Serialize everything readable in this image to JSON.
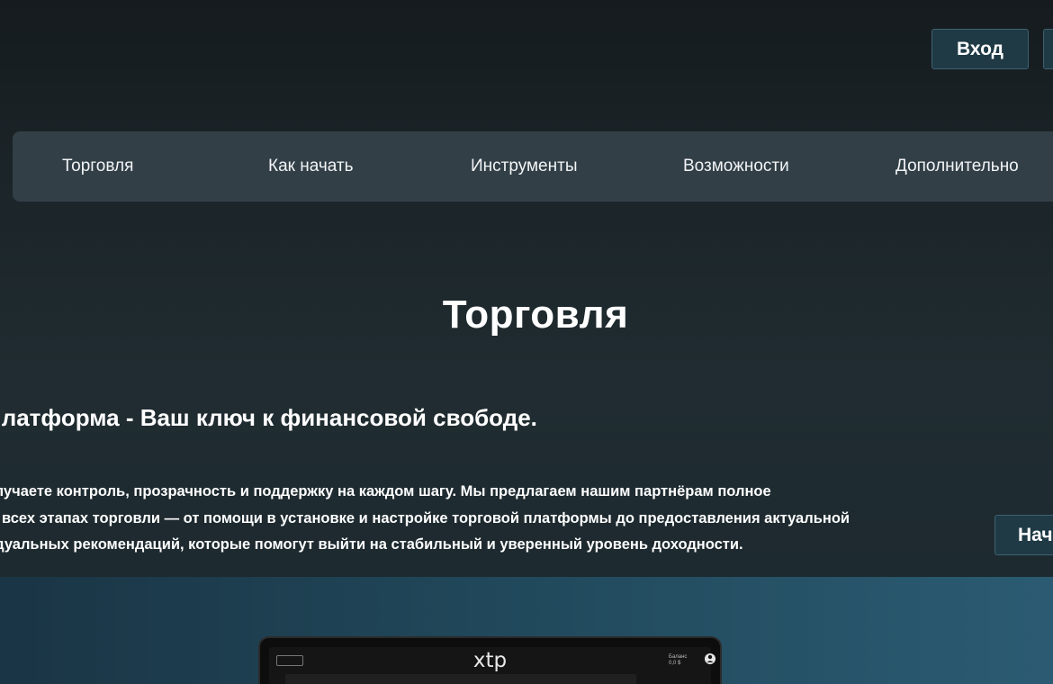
{
  "header": {
    "login_label": "Вход"
  },
  "nav": {
    "items": [
      {
        "label": "Торговля"
      },
      {
        "label": "Как начать"
      },
      {
        "label": "Инструменты"
      },
      {
        "label": "Возможности"
      },
      {
        "label": "Дополнительно"
      }
    ]
  },
  "hero": {
    "title": "Торговля",
    "subtitle": "платформа - Ваш ключ к финансовой свободе.",
    "description_lines": [
      "олучаете контроль, прозрачность и поддержку на каждом шагу. Мы предлагаем нашим партнёрам полное",
      "всех этапах торговли — от помощи в установке и настройке торговой платформы до предоставления актуальной",
      "идуальных рекомендаций, которые помогут выйти на стабильный и уверенный уровень доходности."
    ],
    "start_label": "Нач"
  },
  "preview": {
    "logo": "xtp",
    "balance_label": "Баланс",
    "balance_value": "0,0 $"
  },
  "icons": {
    "menu": "menu-icon",
    "user": "user-icon"
  }
}
